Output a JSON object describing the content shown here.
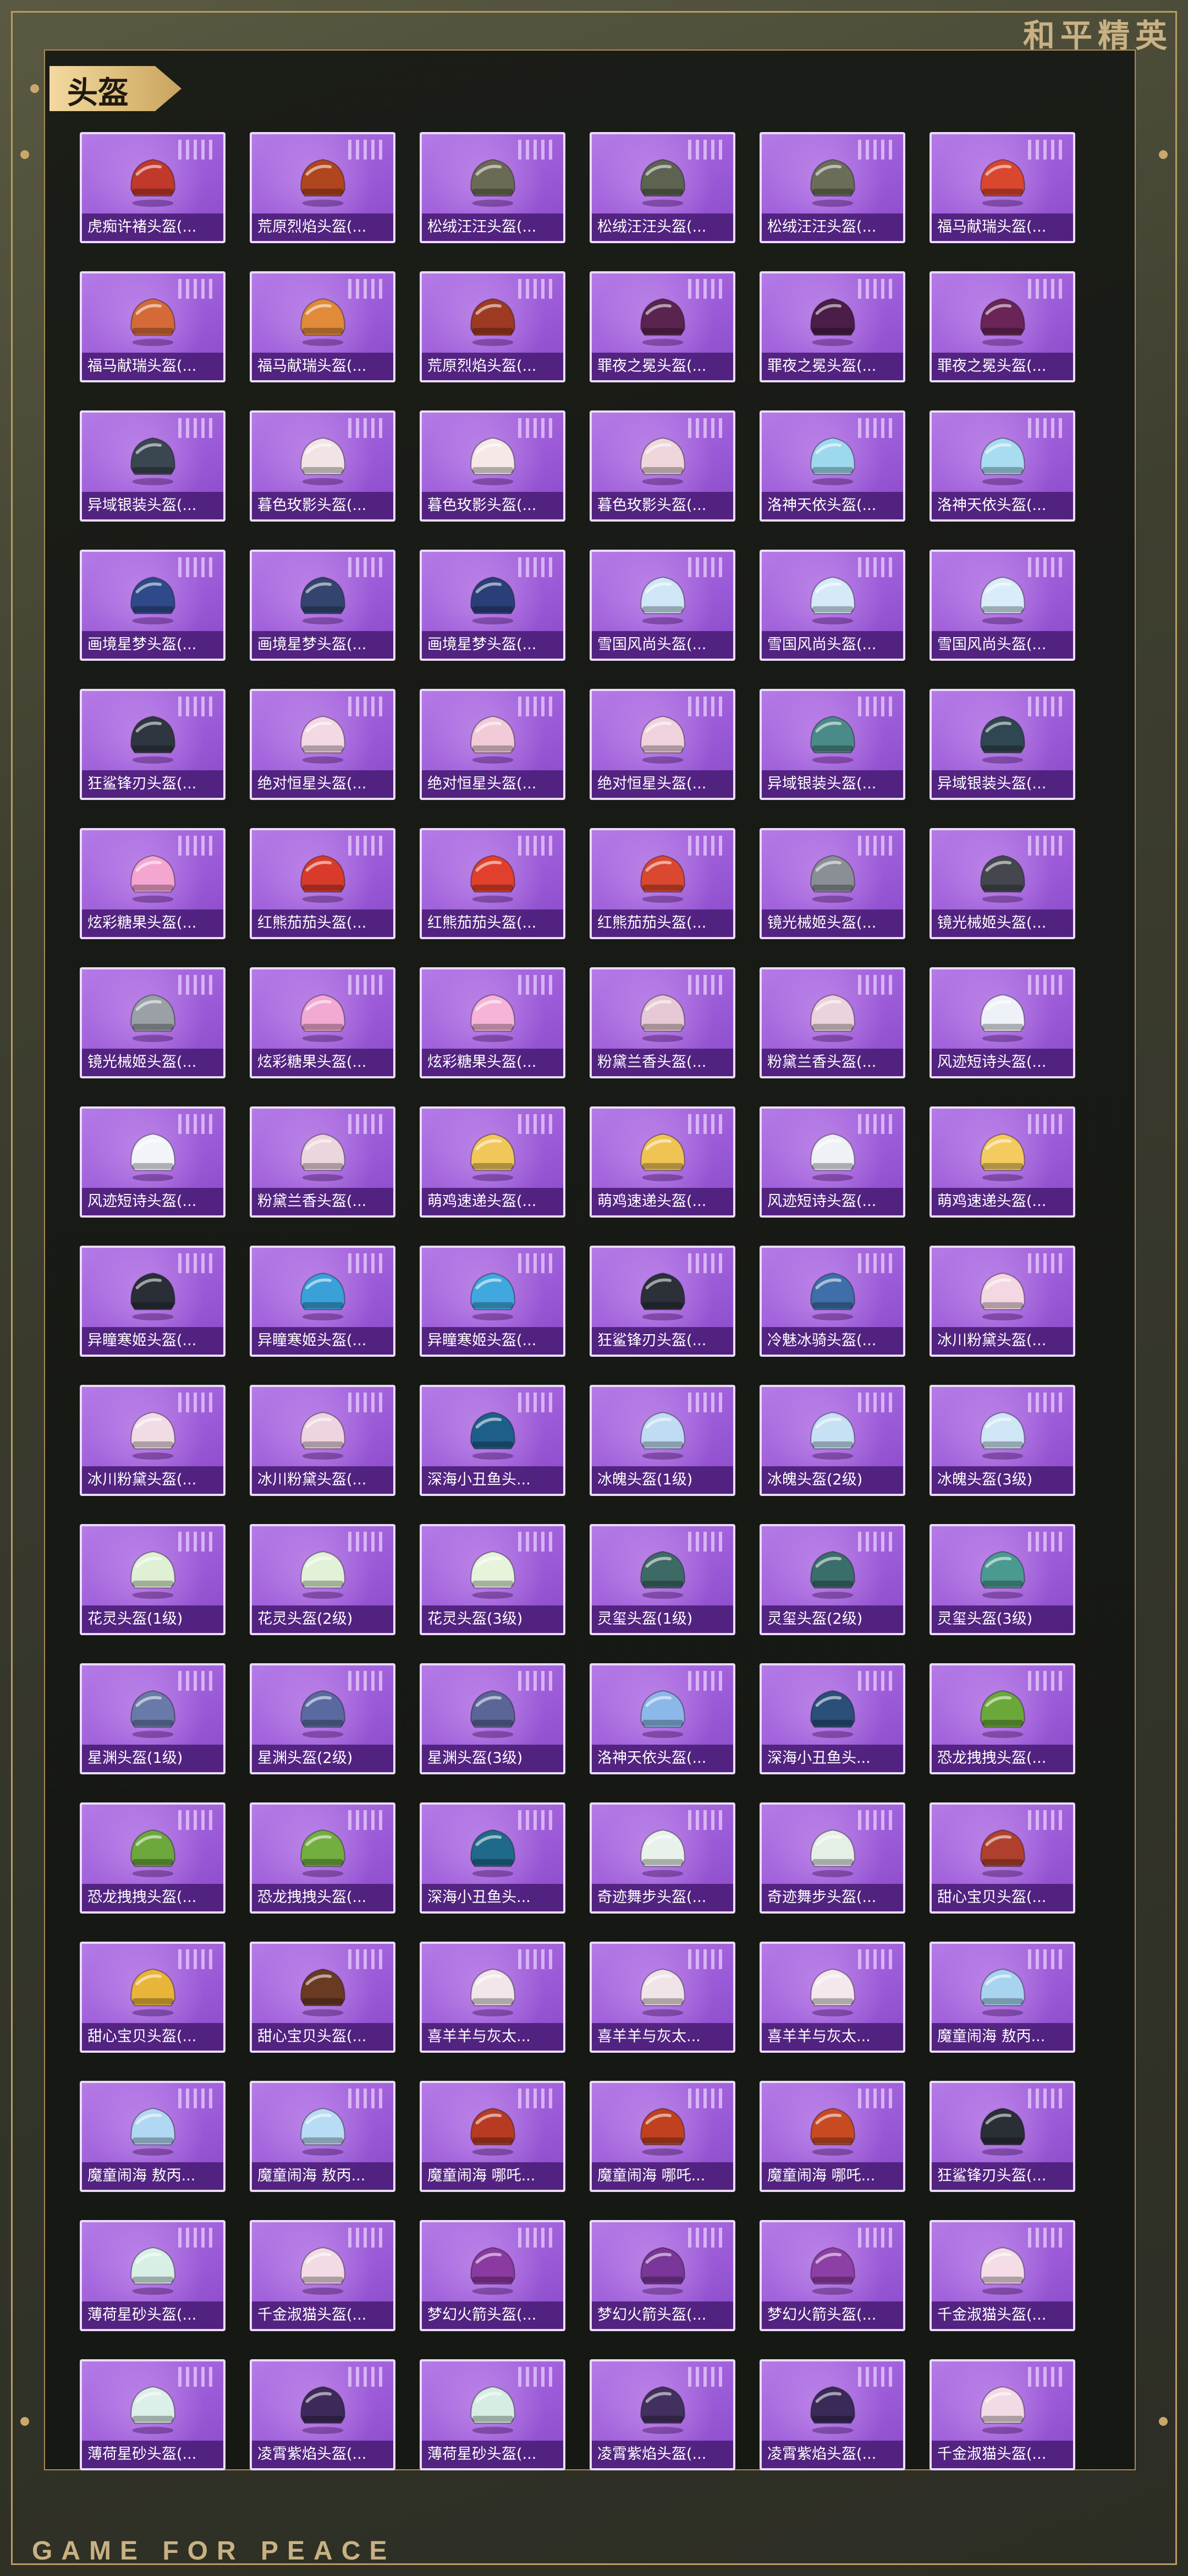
{
  "brand": {
    "top_logo": "和平精英",
    "bottom_text": "GAME FOR PEACE"
  },
  "section": {
    "title": "头盔"
  },
  "items": [
    {
      "label": "虎痴许褚头盔(...",
      "icon": "helmet-icon",
      "color": "#c0392b"
    },
    {
      "label": "荒原烈焰头盔(...",
      "icon": "helmet-icon",
      "color": "#b0461e"
    },
    {
      "label": "松绒汪汪头盔(...",
      "icon": "helmet-icon",
      "color": "#6b6b55"
    },
    {
      "label": "松绒汪汪头盔(...",
      "icon": "helmet-icon",
      "color": "#5c6350"
    },
    {
      "label": "松绒汪汪头盔(...",
      "icon": "helmet-icon",
      "color": "#6a6e58"
    },
    {
      "label": "福马献瑞头盔(...",
      "icon": "helmet-icon",
      "color": "#d9472f"
    },
    {
      "label": "福马献瑞头盔(...",
      "icon": "helmet-icon",
      "color": "#d46a38"
    },
    {
      "label": "福马献瑞头盔(...",
      "icon": "helmet-icon",
      "color": "#e08a3a"
    },
    {
      "label": "荒原烈焰头盔(...",
      "icon": "helmet-icon",
      "color": "#9e3a22"
    },
    {
      "label": "罪夜之冕头盔(...",
      "icon": "helmet-icon",
      "color": "#5a2450"
    },
    {
      "label": "罪夜之冕头盔(...",
      "icon": "helmet-icon",
      "color": "#4a1e48"
    },
    {
      "label": "罪夜之冕头盔(...",
      "icon": "helmet-icon",
      "color": "#6a2458"
    },
    {
      "label": "异域银装头盔(...",
      "icon": "helmet-icon",
      "color": "#3a4650"
    },
    {
      "label": "暮色玫影头盔(...",
      "icon": "helmet-icon",
      "color": "#f2e4e4"
    },
    {
      "label": "暮色玫影头盔(...",
      "icon": "helmet-icon",
      "color": "#f5e8e6"
    },
    {
      "label": "暮色玫影头盔(...",
      "icon": "helmet-icon",
      "color": "#eed6da"
    },
    {
      "label": "洛神天依头盔(...",
      "icon": "helmet-icon",
      "color": "#9ed8ee"
    },
    {
      "label": "洛神天依头盔(...",
      "icon": "helmet-icon",
      "color": "#a8dcf0"
    },
    {
      "label": "画境星梦头盔(...",
      "icon": "helmet-icon",
      "color": "#2e4a8a"
    },
    {
      "label": "画境星梦头盔(...",
      "icon": "helmet-icon",
      "color": "#33446e"
    },
    {
      "label": "画境星梦头盔(...",
      "icon": "helmet-icon",
      "color": "#2a3f7a"
    },
    {
      "label": "雪国风尚头盔(...",
      "icon": "helmet-icon",
      "color": "#cfe6f7"
    },
    {
      "label": "雪国风尚头盔(...",
      "icon": "helmet-icon",
      "color": "#d5eaf8"
    },
    {
      "label": "雪国风尚头盔(...",
      "icon": "helmet-icon",
      "color": "#d9ecfa"
    },
    {
      "label": "狂鲨锋刃头盔(...",
      "icon": "helmet-icon",
      "color": "#2f3640"
    },
    {
      "label": "绝对恒星头盔(...",
      "icon": "helmet-icon",
      "color": "#f3d9e4"
    },
    {
      "label": "绝对恒星头盔(...",
      "icon": "helmet-icon",
      "color": "#f1cbd8"
    },
    {
      "label": "绝对恒星头盔(...",
      "icon": "helmet-icon",
      "color": "#f0d2de"
    },
    {
      "label": "异域银装头盔(...",
      "icon": "helmet-icon",
      "color": "#4a8a88"
    },
    {
      "label": "异域银装头盔(...",
      "icon": "helmet-icon",
      "color": "#2f4750"
    },
    {
      "label": "炫彩糖果头盔(...",
      "icon": "helmet-icon",
      "color": "#f4a6d0"
    },
    {
      "label": "红熊茄茄头盔(...",
      "icon": "helmet-icon",
      "color": "#d83b2a"
    },
    {
      "label": "红熊茄茄头盔(...",
      "icon": "helmet-icon",
      "color": "#e0402c"
    },
    {
      "label": "红熊茄茄头盔(...",
      "icon": "helmet-icon",
      "color": "#d9482f"
    },
    {
      "label": "镜光械姬头盔(...",
      "icon": "helmet-icon",
      "color": "#8a8f96"
    },
    {
      "label": "镜光械姬头盔(...",
      "icon": "helmet-icon",
      "color": "#44484e"
    },
    {
      "label": "镜光械姬头盔(...",
      "icon": "helmet-icon",
      "color": "#9aa0a6"
    },
    {
      "label": "炫彩糖果头盔(...",
      "icon": "helmet-icon",
      "color": "#f2a9d2"
    },
    {
      "label": "炫彩糖果头盔(...",
      "icon": "helmet-icon",
      "color": "#f5b4d8"
    },
    {
      "label": "粉黛兰香头盔(...",
      "icon": "helmet-icon",
      "color": "#e6c9d4"
    },
    {
      "label": "粉黛兰香头盔(...",
      "icon": "helmet-icon",
      "color": "#ead3dc"
    },
    {
      "label": "风迹短诗头盔(...",
      "icon": "helmet-icon",
      "color": "#eef2f8"
    },
    {
      "label": "风迹短诗头盔(...",
      "icon": "helmet-icon",
      "color": "#f1f4f8"
    },
    {
      "label": "粉黛兰香头盔(...",
      "icon": "helmet-icon",
      "color": "#ecd6de"
    },
    {
      "label": "萌鸡速递头盔(...",
      "icon": "helmet-icon",
      "color": "#f2c75a"
    },
    {
      "label": "萌鸡速递头盔(...",
      "icon": "helmet-icon",
      "color": "#f0c454"
    },
    {
      "label": "风迹短诗头盔(...",
      "icon": "helmet-icon",
      "color": "#eef1f6"
    },
    {
      "label": "萌鸡速递头盔(...",
      "icon": "helmet-icon",
      "color": "#f3cb5e"
    },
    {
      "label": "异瞳寒姬头盔(...",
      "icon": "helmet-icon",
      "color": "#2a2e36"
    },
    {
      "label": "异瞳寒姬头盔(...",
      "icon": "helmet-icon",
      "color": "#3aa0d8"
    },
    {
      "label": "异瞳寒姬头盔(...",
      "icon": "helmet-icon",
      "color": "#40a8de"
    },
    {
      "label": "狂鲨锋刃头盔(...",
      "icon": "helmet-icon",
      "color": "#2c3038"
    },
    {
      "label": "冷魅冰骑头盔(...",
      "icon": "helmet-icon",
      "color": "#3e6fa8"
    },
    {
      "label": "冰川粉黛头盔(...",
      "icon": "helmet-icon",
      "color": "#f3d7e2"
    },
    {
      "label": "冰川粉黛头盔(...",
      "icon": "helmet-icon",
      "color": "#f1dce6"
    },
    {
      "label": "冰川粉黛头盔(...",
      "icon": "helmet-icon",
      "color": "#eed4e0"
    },
    {
      "label": "深海小丑鱼头...",
      "icon": "helmet-icon",
      "color": "#1e5f8a"
    },
    {
      "label": "冰魄头盔(1级)",
      "icon": "helmet-icon",
      "color": "#bfdcf2"
    },
    {
      "label": "冰魄头盔(2级)",
      "icon": "helmet-icon",
      "color": "#c6e0f4"
    },
    {
      "label": "冰魄头盔(3级)",
      "icon": "helmet-icon",
      "color": "#cfe6f6"
    },
    {
      "label": "花灵头盔(1级)",
      "icon": "helmet-icon",
      "color": "#dff0d4"
    },
    {
      "label": "花灵头盔(2级)",
      "icon": "helmet-icon",
      "color": "#e2f2d8"
    },
    {
      "label": "花灵头盔(3级)",
      "icon": "helmet-icon",
      "color": "#e6f4dc"
    },
    {
      "label": "灵玺头盔(1级)",
      "icon": "helmet-icon",
      "color": "#3e6a66"
    },
    {
      "label": "灵玺头盔(2级)",
      "icon": "helmet-icon",
      "color": "#3a6e6a"
    },
    {
      "label": "灵玺头盔(3级)",
      "icon": "helmet-icon",
      "color": "#4a9a92"
    },
    {
      "label": "星渊头盔(1级)",
      "icon": "helmet-icon",
      "color": "#6a7aa8"
    },
    {
      "label": "星渊头盔(2级)",
      "icon": "helmet-icon",
      "color": "#5a6aa0"
    },
    {
      "label": "星渊头盔(3级)",
      "icon": "helmet-icon",
      "color": "#5a6698"
    },
    {
      "label": "洛神天依头盔(...",
      "icon": "helmet-icon",
      "color": "#8ab8e8"
    },
    {
      "label": "深海小丑鱼头...",
      "icon": "helmet-icon",
      "color": "#2a4f78"
    },
    {
      "label": "恐龙拽拽头盔(...",
      "icon": "helmet-icon",
      "color": "#6aa83a"
    },
    {
      "label": "恐龙拽拽头盔(...",
      "icon": "helmet-icon",
      "color": "#6ca83c"
    },
    {
      "label": "恐龙拽拽头盔(...",
      "icon": "helmet-icon",
      "color": "#72ae40"
    },
    {
      "label": "深海小丑鱼头...",
      "icon": "helmet-icon",
      "color": "#1f6a8a"
    },
    {
      "label": "奇迹舞步头盔(...",
      "icon": "helmet-icon",
      "color": "#e8f2ea"
    },
    {
      "label": "奇迹舞步头盔(...",
      "icon": "helmet-icon",
      "color": "#e4efe6"
    },
    {
      "label": "甜心宝贝头盔(...",
      "icon": "helmet-icon",
      "color": "#b0402e"
    },
    {
      "label": "甜心宝贝头盔(...",
      "icon": "helmet-icon",
      "color": "#e8b43a"
    },
    {
      "label": "甜心宝贝头盔(...",
      "icon": "helmet-icon",
      "color": "#6a3a22"
    },
    {
      "label": "喜羊羊与灰太...",
      "icon": "helmet-icon",
      "color": "#f3e6ea"
    },
    {
      "label": "喜羊羊与灰太...",
      "icon": "helmet-icon",
      "color": "#f1e4e8"
    },
    {
      "label": "喜羊羊与灰太...",
      "icon": "helmet-icon",
      "color": "#f4e8ec"
    },
    {
      "label": "魔童闹海 敖丙...",
      "icon": "helmet-icon",
      "color": "#a8d4f0"
    },
    {
      "label": "魔童闹海 敖丙...",
      "icon": "helmet-icon",
      "color": "#b0d8f2"
    },
    {
      "label": "魔童闹海 敖丙...",
      "icon": "helmet-icon",
      "color": "#b8dcf4"
    },
    {
      "label": "魔童闹海 哪吒...",
      "icon": "helmet-icon",
      "color": "#b83a22"
    },
    {
      "label": "魔童闹海 哪吒...",
      "icon": "helmet-icon",
      "color": "#c0401f"
    },
    {
      "label": "魔童闹海 哪吒...",
      "icon": "helmet-icon",
      "color": "#c84a22"
    },
    {
      "label": "狂鲨锋刃头盔(...",
      "icon": "helmet-icon",
      "color": "#2a2e36"
    },
    {
      "label": "薄荷星砂头盔(...",
      "icon": "helmet-icon",
      "color": "#d8efe6"
    },
    {
      "label": "千金淑猫头盔(...",
      "icon": "helmet-icon",
      "color": "#f2dbe4"
    },
    {
      "label": "梦幻火箭头盔(...",
      "icon": "helmet-icon",
      "color": "#8a3aa0"
    },
    {
      "label": "梦幻火箭头盔(...",
      "icon": "helmet-icon",
      "color": "#7a3698"
    },
    {
      "label": "梦幻火箭头盔(...",
      "icon": "helmet-icon",
      "color": "#8e3fa6"
    },
    {
      "label": "千金淑猫头盔(...",
      "icon": "helmet-icon",
      "color": "#f4dde6"
    },
    {
      "label": "薄荷星砂头盔(...",
      "icon": "helmet-icon",
      "color": "#dcefe8"
    },
    {
      "label": "凌霄紫焰头盔(...",
      "icon": "helmet-icon",
      "color": "#3e2a5a"
    },
    {
      "label": "薄荷星砂头盔(...",
      "icon": "helmet-icon",
      "color": "#d6ede4"
    },
    {
      "label": "凌霄紫焰头盔(...",
      "icon": "helmet-icon",
      "color": "#42305e"
    },
    {
      "label": "凌霄紫焰头盔(...",
      "icon": "helmet-icon",
      "color": "#3a2a58"
    },
    {
      "label": "千金淑猫头盔(...",
      "icon": "helmet-icon",
      "color": "#f2dbe4"
    }
  ]
}
